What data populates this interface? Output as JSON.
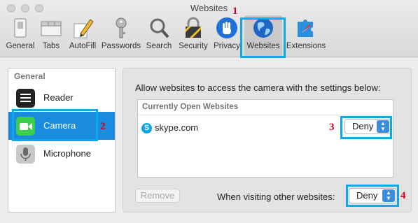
{
  "window": {
    "title": "Websites"
  },
  "toolbar": {
    "items": [
      {
        "label": "General",
        "icon": "general-switch-icon"
      },
      {
        "label": "Tabs",
        "icon": "tabs-icon"
      },
      {
        "label": "AutoFill",
        "icon": "pencil-icon"
      },
      {
        "label": "Passwords",
        "icon": "key-icon"
      },
      {
        "label": "Search",
        "icon": "magnifier-icon"
      },
      {
        "label": "Security",
        "icon": "lock-icon"
      },
      {
        "label": "Privacy",
        "icon": "hand-icon"
      },
      {
        "label": "Websites",
        "icon": "globe-icon"
      },
      {
        "label": "Extensions",
        "icon": "puzzle-icon"
      }
    ],
    "active": "Websites"
  },
  "annotations": {
    "one": "1",
    "two": "2",
    "three": "3",
    "four": "4"
  },
  "sidebar": {
    "header": "General",
    "items": [
      {
        "label": "Reader",
        "icon": "reader-icon"
      },
      {
        "label": "Camera",
        "icon": "camera-icon",
        "selected": true
      },
      {
        "label": "Microphone",
        "icon": "microphone-icon"
      }
    ]
  },
  "panel": {
    "description": "Allow websites to access the camera with the settings below:",
    "list_header": "Currently Open Websites",
    "rows": [
      {
        "site": "skype.com",
        "setting": "Deny",
        "logo_letter": "S"
      }
    ],
    "remove_label": "Remove",
    "other_label": "When visiting other websites:",
    "other_setting": "Deny"
  },
  "colors": {
    "highlight": "#10a7e6",
    "selection": "#1a8ce0",
    "annotation": "#d0021b"
  }
}
